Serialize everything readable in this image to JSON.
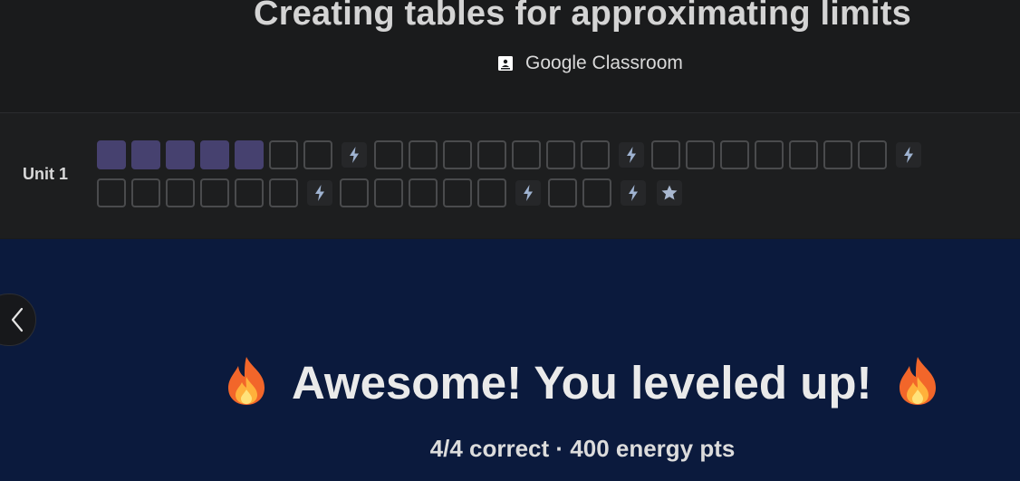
{
  "header": {
    "title": "Creating tables for approximating limits",
    "classroom_label": "Google Classroom",
    "classroom_icon": "google-classroom-icon"
  },
  "progress": {
    "unit_label": "Unit 1",
    "filled_color": "#46416f",
    "row1": [
      "filled",
      "filled",
      "filled",
      "filled",
      "filled",
      "empty",
      "empty",
      "bolt",
      "empty",
      "empty",
      "empty",
      "empty",
      "empty",
      "empty",
      "empty",
      "bolt",
      "empty",
      "empty",
      "empty",
      "empty",
      "empty",
      "empty",
      "empty",
      "bolt"
    ],
    "row2": [
      "empty",
      "empty",
      "empty",
      "empty",
      "empty",
      "empty",
      "bolt",
      "empty",
      "empty",
      "empty",
      "empty",
      "empty",
      "bolt",
      "empty",
      "empty",
      "bolt",
      "star"
    ]
  },
  "result": {
    "message": "Awesome! You leveled up!",
    "stats": "4/4 correct · 400 energy pts",
    "icon": "fire-icon",
    "background": "#0b1a3d"
  },
  "nav": {
    "back_icon": "chevron-left-icon"
  }
}
